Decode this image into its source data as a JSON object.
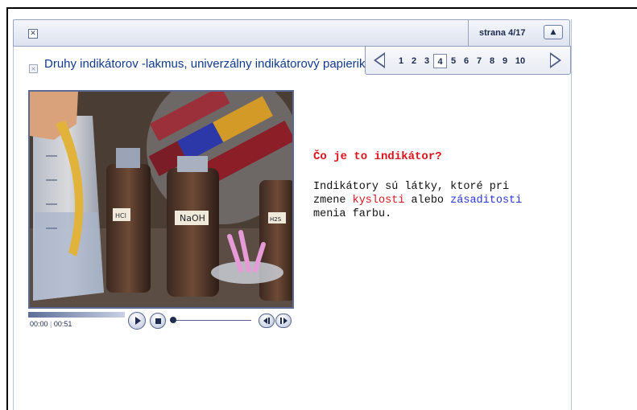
{
  "toolbar": {
    "close_glyph": "✕",
    "page_label": "strana 4/17",
    "collapse_glyph": "▲"
  },
  "pager": {
    "pages": [
      "1",
      "2",
      "3",
      "4",
      "5",
      "6",
      "7",
      "8",
      "9",
      "10"
    ],
    "current": "4"
  },
  "lesson": {
    "title": "Druhy indikátorov -lakmus, univerzálny indikátorový papierik"
  },
  "image": {
    "labels": [
      "HCl",
      "NaOH",
      "H2S"
    ]
  },
  "media": {
    "elapsed": "00:00",
    "separator": "|",
    "duration": "00:51"
  },
  "content": {
    "question": "Čo je to indikátor?",
    "p1": "Indikátory sú látky, ktoré pri",
    "p2a": "zmene ",
    "kw1": "kyslosti",
    "p2b": " alebo ",
    "kw2": "zásaditosti",
    "p3": "menia farbu."
  },
  "colors": {
    "title": "#103a8a",
    "question": "#d8141d",
    "kw_acid": "#d8141d",
    "kw_base": "#2a37d0"
  },
  "icons": [
    "close-icon",
    "collapse-icon",
    "prev-arrow-icon",
    "next-arrow-icon",
    "play-icon",
    "stop-icon",
    "rewind-icon",
    "forward-icon"
  ]
}
